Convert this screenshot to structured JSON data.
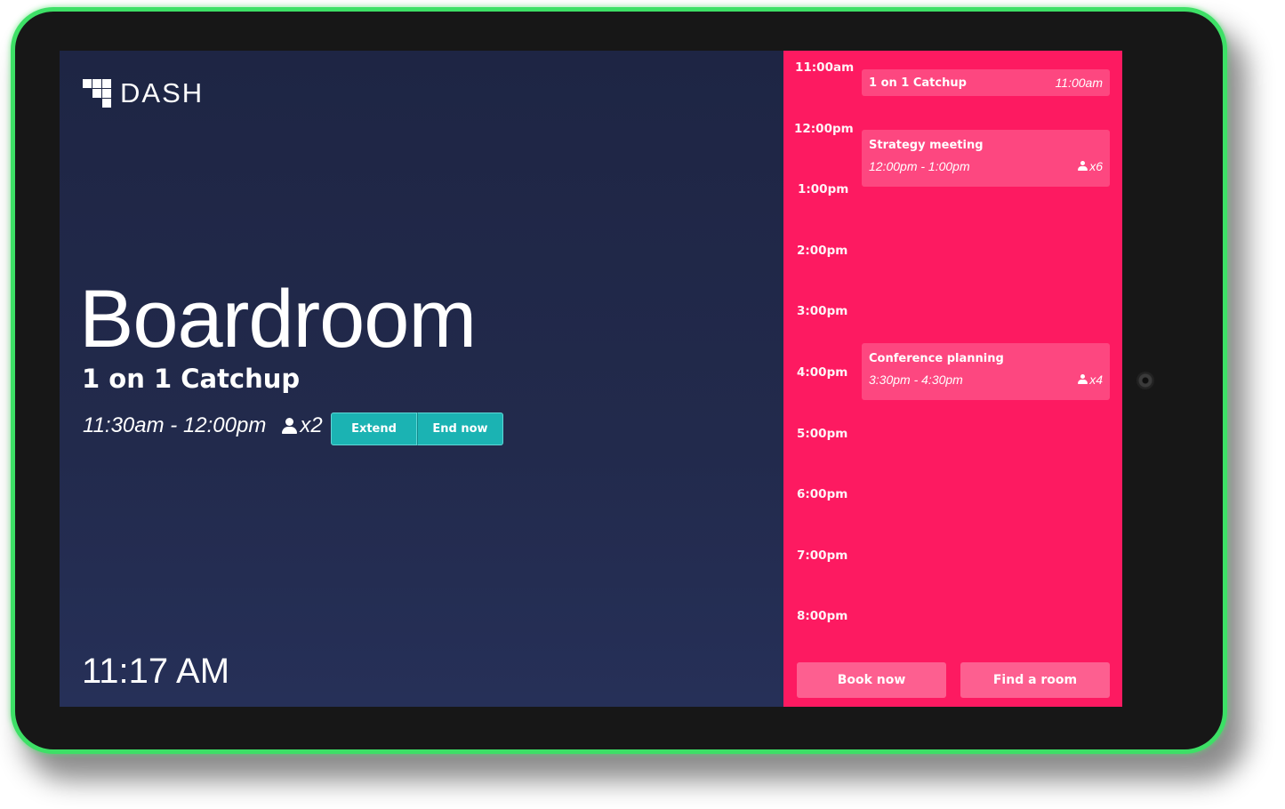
{
  "device": {
    "bezel_color": "#171717",
    "led_color": "#3de066"
  },
  "brand": {
    "logo_icon": "dash-logo-icon",
    "name": "DASH"
  },
  "room": {
    "name": "Boardroom"
  },
  "current_meeting": {
    "title": "1 on 1 Catchup",
    "time_range": "11:30am - 12:00pm",
    "attendees_icon": "person-icon",
    "attendees": "x2",
    "actions": {
      "extend_label": "Extend",
      "end_label": "End now"
    }
  },
  "clock": "11:17 AM",
  "schedule": {
    "accent_color": "#fd1a61",
    "hours": [
      "11:00am",
      "12:00pm",
      "1:00pm",
      "2:00pm",
      "3:00pm",
      "4:00pm",
      "5:00pm",
      "6:00pm",
      "7:00pm",
      "8:00pm"
    ],
    "events": [
      {
        "title": "1 on 1 Catchup",
        "time": "11:00am"
      },
      {
        "title": "Strategy meeting",
        "time": "12:00pm - 1:00pm",
        "attendees": "x6"
      },
      {
        "title": "Conference planning",
        "time": "3:30pm - 4:30pm",
        "attendees": "x4"
      }
    ],
    "book_label": "Book now",
    "find_label": "Find a room"
  },
  "colors": {
    "left_bg": "#1e2544",
    "teal_button": "#1bb3b3"
  }
}
